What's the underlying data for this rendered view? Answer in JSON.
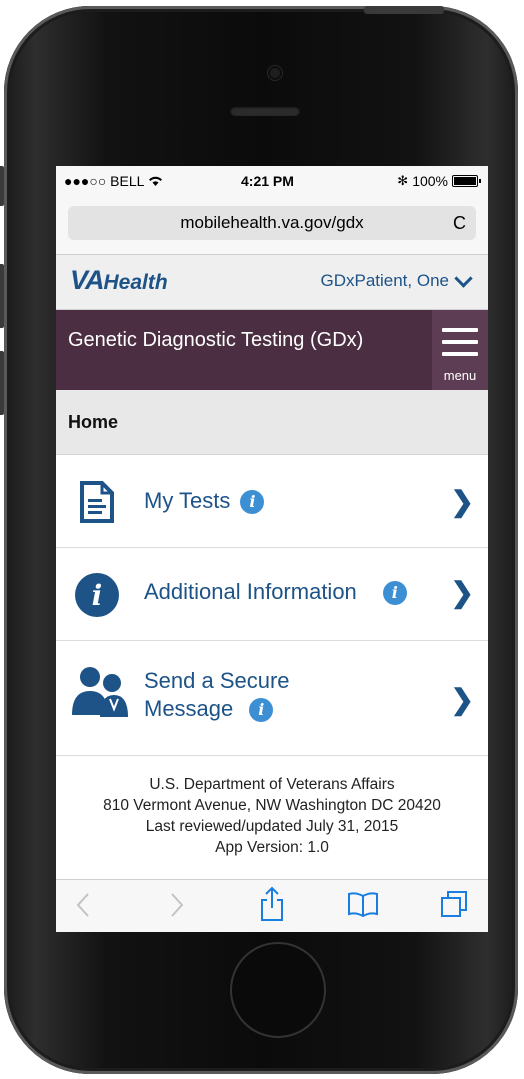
{
  "status_bar": {
    "carrier": "●●●○○ BELL",
    "wifi_icon": "wifi-icon",
    "time": "4:21 PM",
    "bluetooth": "∦",
    "battery": "100%"
  },
  "browser": {
    "url": "mobilehealth.va.gov/gdx",
    "reload_icon": "C"
  },
  "header": {
    "logo_va": "VA",
    "logo_health": "Health",
    "user_name": "GDxPatient, One"
  },
  "titlebar": {
    "title": "Genetic Diagnostic Testing (GDx)",
    "menu_label": "menu"
  },
  "breadcrumb": {
    "current": "Home"
  },
  "menu_items": [
    {
      "label": "My Tests",
      "icon": "document-icon"
    },
    {
      "label": "Additional Information",
      "icon": "info-icon"
    },
    {
      "label_line1": "Send a Secure",
      "label_line2": "Message",
      "icon": "people-icon"
    }
  ],
  "footer": {
    "org": "U.S. Department of Veterans Affairs",
    "address": "810 Vermont Avenue, NW Washington DC 20420",
    "reviewed": "Last reviewed/updated July 31, 2015",
    "version": "App Version: 1.0"
  },
  "colors": {
    "brand_blue": "#1d5387",
    "title_purple": "#4b2e42",
    "info_blue": "#3d8fd4"
  }
}
